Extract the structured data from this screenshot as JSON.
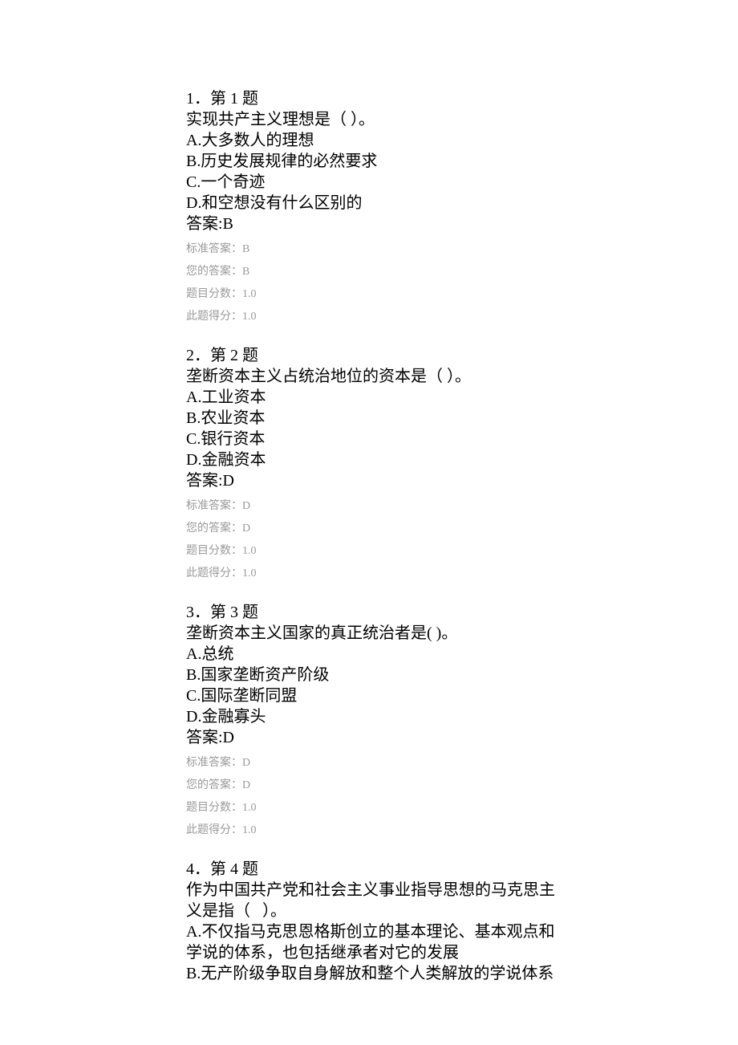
{
  "questions": [
    {
      "number": "1．第 1 题",
      "stem": "实现共产主义理想是（ ）。",
      "options": [
        "A.大多数人的理想",
        "B.历史发展规律的必然要求",
        "C.一个奇迹",
        "D.和空想没有什么区别的"
      ],
      "answer_line": "答案:B",
      "meta": {
        "standard": "标准答案：B",
        "your": "您的答案：B",
        "full": "题目分数：1.0",
        "got": "此题得分：1.0"
      }
    },
    {
      "number": "2．第 2 题",
      "stem": "垄断资本主义占统治地位的资本是（ ）。",
      "options": [
        "A.工业资本",
        "B.农业资本",
        "C.银行资本",
        "D.金融资本"
      ],
      "answer_line": "答案:D",
      "meta": {
        "standard": "标准答案：D",
        "your": "您的答案：D",
        "full": "题目分数：1.0",
        "got": "此题得分：1.0"
      }
    },
    {
      "number": "3．第 3 题",
      "stem": "垄断资本主义国家的真正统治者是( )。",
      "options": [
        "A.总统",
        "B.国家垄断资产阶级",
        "C.国际垄断同盟",
        "D.金融寡头"
      ],
      "answer_line": "答案:D",
      "meta": {
        "standard": "标准答案：D",
        "your": "您的答案：D",
        "full": "题目分数：1.0",
        "got": "此题得分：1.0"
      }
    },
    {
      "number": "4．第 4 题",
      "stem": "作为中国共产党和社会主义事业指导思想的马克思主义是指（   ）。",
      "options": [
        "A.不仅指马克思恩格斯创立的基本理论、基本观点和学说的体系，也包括继承者对它的发展",
        "B.无产阶级争取自身解放和整个人类解放的学说体系"
      ],
      "answer_line": null,
      "meta": null
    }
  ]
}
